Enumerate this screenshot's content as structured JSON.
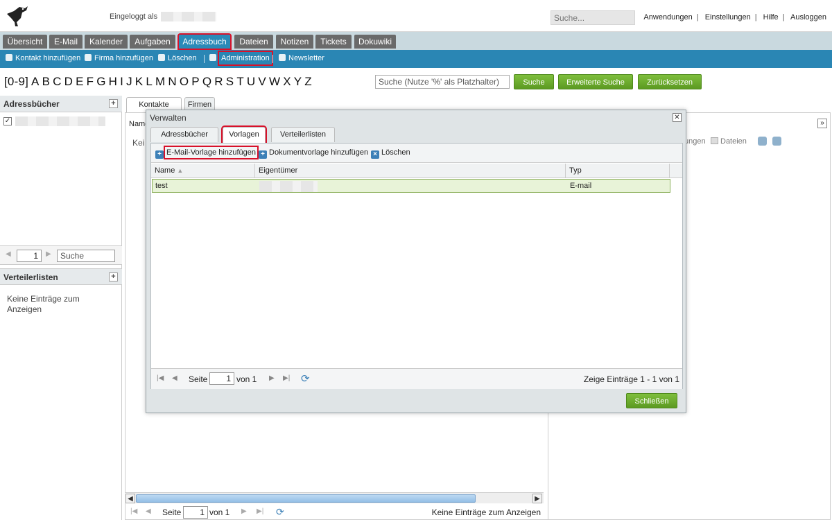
{
  "header": {
    "logged_in_label": "Eingeloggt als",
    "search_placeholder": "Suche...",
    "links": [
      "Anwendungen",
      "Einstellungen",
      "Hilfe",
      "Ausloggen"
    ]
  },
  "modules": [
    "Übersicht",
    "E-Mail",
    "Kalender",
    "Aufgaben",
    "Adressbuch",
    "Dateien",
    "Notizen",
    "Tickets",
    "Dokuwiki"
  ],
  "actions": {
    "add_contact": "Kontakt hinzufügen",
    "add_company": "Firma hinzufügen",
    "delete": "Löschen",
    "administration": "Administration",
    "newsletter": "Newsletter"
  },
  "alphabet": [
    "[0-9]",
    "A",
    "B",
    "C",
    "D",
    "E",
    "F",
    "G",
    "H",
    "I",
    "J",
    "K",
    "L",
    "M",
    "N",
    "O",
    "P",
    "Q",
    "R",
    "S",
    "T",
    "U",
    "V",
    "W",
    "X",
    "Y",
    "Z"
  ],
  "search": {
    "placeholder": "Suche (Nutze '%' als Platzhalter)",
    "search_btn": "Suche",
    "advanced_btn": "Erweiterte Suche",
    "reset_btn": "Zurücksetzen"
  },
  "left": {
    "addressbooks_title": "Adressbücher",
    "page_value": "1",
    "search_placeholder": "Suche",
    "lists_title": "Verteilerlisten",
    "no_entries": "Keine Einträge zum Anzeigen"
  },
  "main": {
    "tabs": [
      "Kontakte",
      "Firmen"
    ],
    "col_name_partial": "Name",
    "no_entries_partial": "Kei",
    "bottom_page_label": "Seite",
    "bottom_page_value": "1",
    "bottom_of": "von 1",
    "bottom_status": "Keine Einträge zum Anzeigen"
  },
  "right": {
    "partial_labels": [
      "ungen",
      "Dateien"
    ]
  },
  "modal": {
    "title": "Verwalten",
    "tabs": [
      "Adressbücher",
      "Vorlagen",
      "Verteilerlisten"
    ],
    "toolbar": {
      "add_email_template": "E-Mail-Vorlage hinzufügen",
      "add_doc_template": "Dokumentvorlage hinzufügen",
      "delete": "Löschen"
    },
    "columns": [
      "Name",
      "Eigentümer",
      "Typ"
    ],
    "rows": [
      {
        "name": "test",
        "type": "E-mail"
      }
    ],
    "pager": {
      "page_label": "Seite",
      "page_value": "1",
      "of": "von 1",
      "status": "Zeige Einträge 1 - 1 von 1"
    },
    "close_btn": "Schließen"
  }
}
